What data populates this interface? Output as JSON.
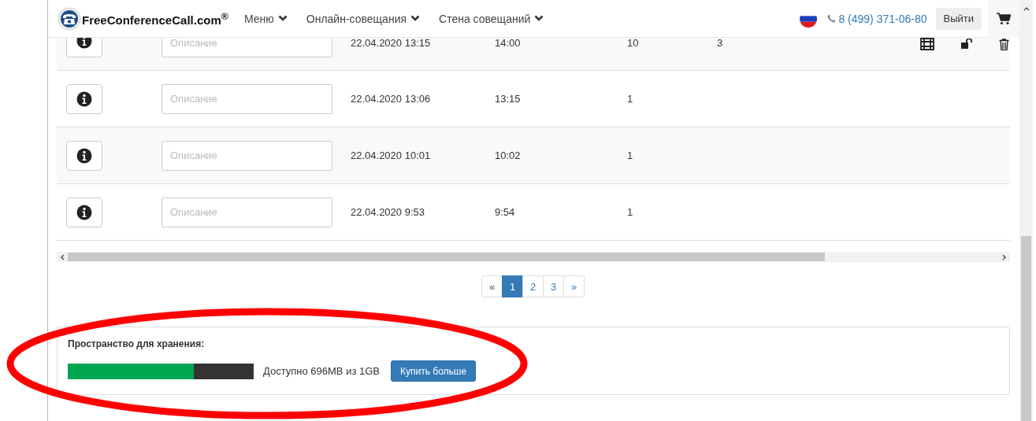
{
  "header": {
    "logo": "FreeConferenceCall.com$^{®}$",
    "menu": [
      {
        "label": "Меню"
      },
      {
        "label": "Онлайн-совещания"
      },
      {
        "label": "Стена совещаний"
      }
    ],
    "phone": "8 (499) 371-06-80",
    "logout": "Выйти"
  },
  "rows": [
    {
      "description_placeholder": "Описание",
      "start": "22.04.2020 13:15",
      "end": "14:00",
      "column_4": "10",
      "column_5": "3",
      "actions": true
    },
    {
      "description_placeholder": "Описание",
      "start": "22.04.2020 13:06",
      "end": "13:15",
      "column_4": "1",
      "column_5": "",
      "actions": false
    },
    {
      "description_placeholder": "Описание",
      "start": "22.04.2020 10:01",
      "end": "10:02",
      "column_4": "1",
      "column_5": "",
      "actions": false
    },
    {
      "description_placeholder": "Описание",
      "start": "22.04.2020 9:53",
      "end": "9:54",
      "column_4": "1",
      "column_5": "",
      "actions": false
    }
  ],
  "pagination": [
    {
      "label": "«",
      "selected": false
    },
    {
      "label": "1",
      "selected": true
    },
    {
      "label": "2",
      "selected": false
    },
    {
      "label": "3",
      "selected": false
    },
    {
      "label": "»",
      "selected": false
    }
  ],
  "storage": {
    "title": "Пространство для хранения:",
    "level": 0.68,
    "text": "Доступно 696MB из 1GB",
    "button": "Купить больше"
  }
}
